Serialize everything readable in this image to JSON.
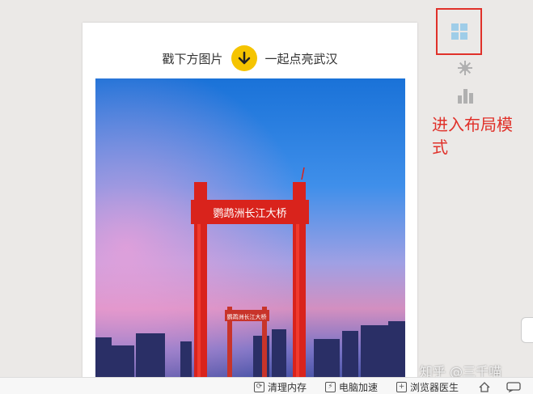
{
  "card": {
    "hint_before": "戳下方图片",
    "hint_after": "一起点亮武汉",
    "photo_sign": "鹦鹉洲长江大桥"
  },
  "sidebar": {
    "layout_icon": "grid-layout-icon",
    "settings_icon": "gear-icon",
    "stats_icon": "bar-chart-icon"
  },
  "annotation": {
    "text": "进入布局模式"
  },
  "bottom_bar": {
    "tools": [
      {
        "icon": "broom-icon",
        "label": "清理内存"
      },
      {
        "icon": "lightning-icon",
        "label": "电脑加速"
      },
      {
        "icon": "browser-doctor-icon",
        "label": "浏览器医生"
      }
    ]
  },
  "watermark": "知乎 @三千喵",
  "colors": {
    "accent_red": "#e0312a",
    "layout_icon_blue": "#9fcde8",
    "arrow_yellow": "#f5c400"
  }
}
